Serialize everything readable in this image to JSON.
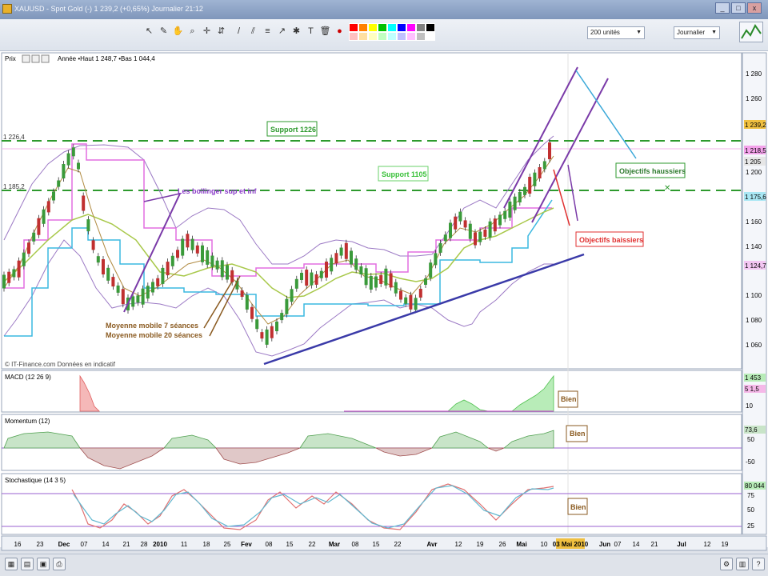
{
  "window": {
    "title": "XAUUSD - Spot Gold (-)  1 239,2 (+0,65%)   Journalier  21:12"
  },
  "toolbar": {
    "units_select": "200 unités",
    "period_select": "Journalier",
    "palette_colors": [
      "#ff0000",
      "#ff8000",
      "#ffff00",
      "#00c000",
      "#00ffff",
      "#0000ff",
      "#ff00ff",
      "#808080",
      "#000000",
      "#ffc0c0",
      "#ffe0a0",
      "#ffffc0",
      "#c0ffc0",
      "#c0ffff",
      "#c0c0ff",
      "#ffc0ff",
      "#c0c0c0",
      "#ffffff"
    ]
  },
  "price_panel": {
    "label": "Prix",
    "info": "Année  •Haut 1 248,7 •Bas 1 044,4",
    "source_note": "© IT-Finance.com  Données en indicatif",
    "level_labels": [
      "1 226,4",
      "1 185,2"
    ],
    "y_ticks": [
      "1 280",
      "1 260",
      "1 200",
      "1 160",
      "1 140",
      "1 100",
      "1 080",
      "1 060"
    ],
    "price_tags": [
      {
        "text": "1 239,2",
        "bg": "#f0c040"
      },
      {
        "text": "1 218,5",
        "bg": "#f3a2ea"
      },
      {
        "text": "1 205",
        "bg": "#e6e6e6"
      },
      {
        "text": "1 175,6",
        "bg": "#a8e7f4"
      },
      {
        "text": "1 124,7",
        "bg": "#f3c6f2"
      }
    ],
    "annotations": {
      "support_1226": "Support 1226",
      "support_1105": "Support 1105",
      "bollingers": "Les bollinger sup et inf",
      "mm7": "Moyenne mobile 7 séances",
      "mm20": "Moyenne mobile 20 séances",
      "objectifs_haussiers": "Objectifs haussiers",
      "objectifs_baissiers": "Objectifs baissiers"
    }
  },
  "macd_panel": {
    "label": "MACD (12 26 9)",
    "tags": [
      "1 453",
      "5 1,5"
    ],
    "tick": "10",
    "badge": "Bien"
  },
  "momentum_panel": {
    "label": "Momentum (12)",
    "tags": [
      "73,6"
    ],
    "ticks": [
      "50",
      "-50"
    ],
    "badge": "Bien"
  },
  "stoch_panel": {
    "label": "Stochastique (14 3 5)",
    "tags": [
      "80 044"
    ],
    "ticks": [
      "75",
      "50",
      "25"
    ],
    "badge": "Bien"
  },
  "x_axis": {
    "labels": [
      "16",
      "23",
      "Dec",
      "07",
      "14",
      "21",
      "28",
      "2010",
      "11",
      "18",
      "25",
      "Fev",
      "08",
      "15",
      "22",
      "Mar",
      "08",
      "15",
      "22",
      "Avr",
      "12",
      "19",
      "26",
      "Mai",
      "10",
      "03 Mai 2010",
      "Jun",
      "07",
      "14",
      "21",
      "Jul",
      "12",
      "19"
    ]
  }
}
